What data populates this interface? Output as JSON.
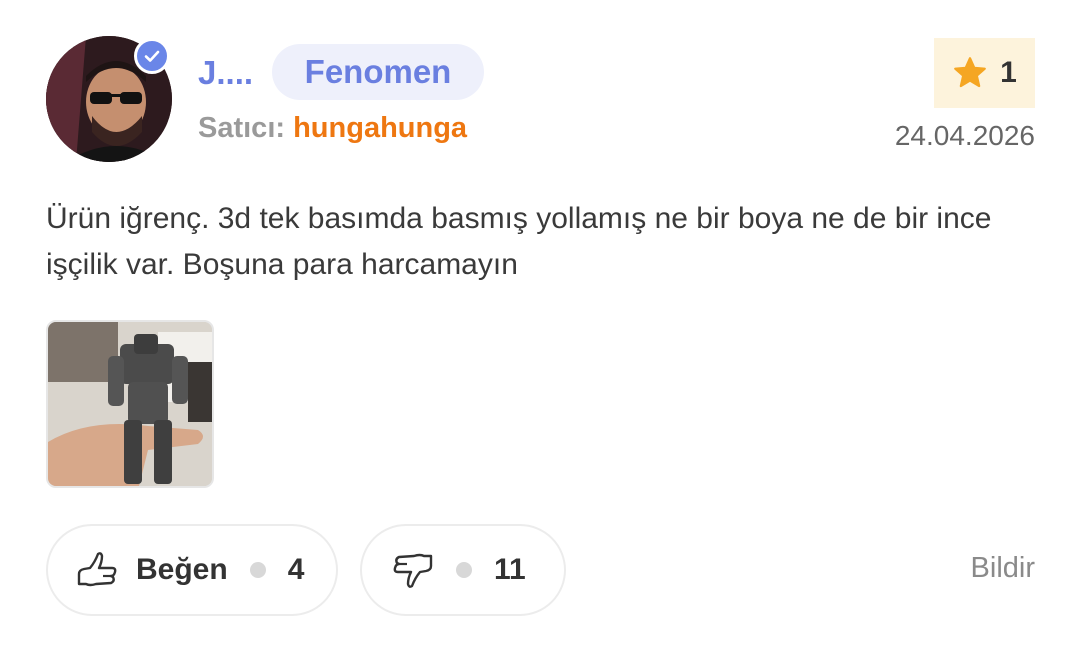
{
  "review": {
    "username": "J....",
    "badge": "Fenomen",
    "seller_label": "Satıcı:",
    "seller_name": "hungahunga",
    "rating": "1",
    "date": "24.04.2026",
    "text": "Ürün iğrenç. 3d tek basımda basmış yollamış ne bir boya ne de bir ince işçilik var. Boşuna para harcamayın"
  },
  "actions": {
    "like_label": "Beğen",
    "like_count": "4",
    "dislike_count": "11",
    "report_label": "Bildir"
  },
  "colors": {
    "accent": "#6a7fe0",
    "seller": "#ee7711",
    "star": "#f5a623"
  },
  "icons": [
    "verified-check-icon",
    "star-icon",
    "thumbs-up-icon",
    "thumbs-down-icon"
  ]
}
